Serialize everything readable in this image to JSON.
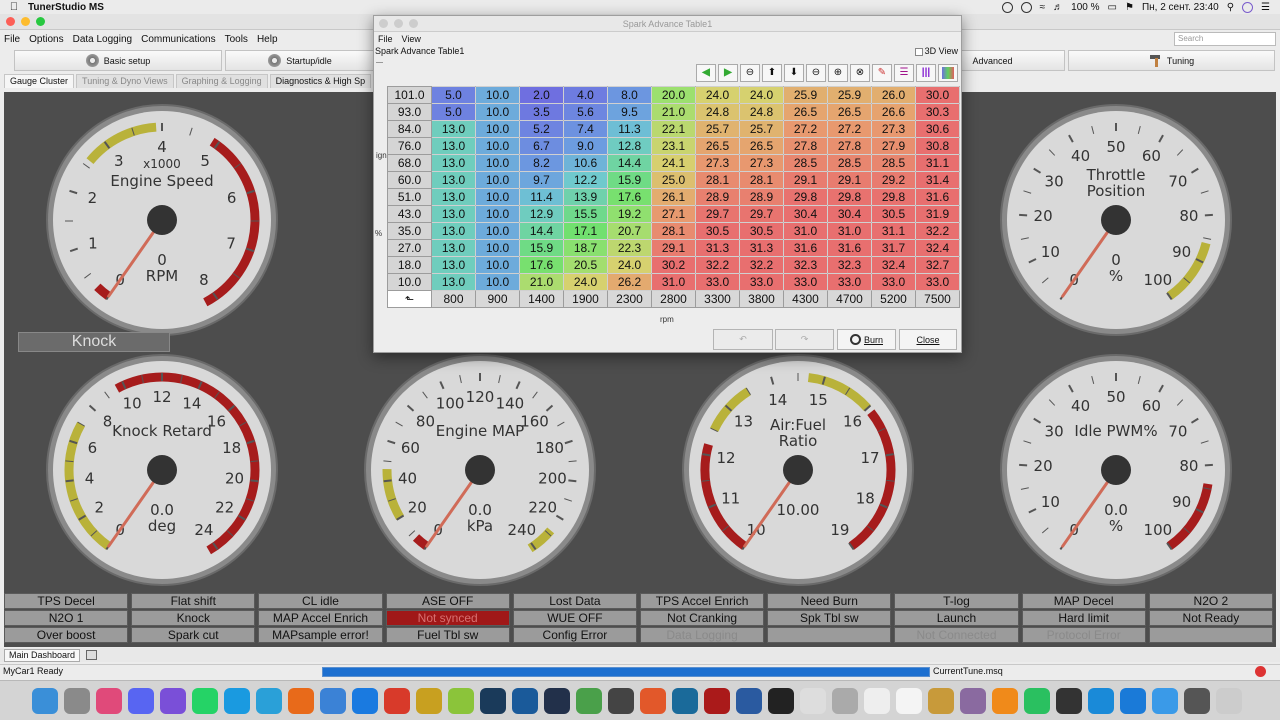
{
  "mac_menubar": {
    "app_name": "TunerStudio MS",
    "wifi": "100 %",
    "date_time": "Пн, 2 сент.  23:40"
  },
  "menu": {
    "items": [
      "File",
      "Options",
      "Data Logging",
      "Communications",
      "Tools",
      "Help"
    ],
    "search_placeholder": "Search"
  },
  "toolbar": {
    "basic_setup": "Basic setup",
    "startup_idle": "Startup/idle",
    "advanced": "Advanced",
    "tuning": "Tuning"
  },
  "tabs": [
    "Gauge Cluster",
    "Tuning & Dyno Views",
    "Graphing & Logging",
    "Diagnostics & High Sp"
  ],
  "gauges": [
    {
      "title": "Engine Speed",
      "sub": "x1000",
      "value": "0",
      "unit": "RPM",
      "ticks": [
        "0",
        "1",
        "2",
        "3",
        "4",
        "5",
        "6",
        "7",
        "8"
      ]
    },
    {
      "title": "Throttle Position",
      "value": "0",
      "unit": "%",
      "ticks": [
        "0",
        "10",
        "20",
        "30",
        "40",
        "50",
        "60",
        "70",
        "80",
        "90",
        "100"
      ]
    },
    {
      "title": "Knock Retard",
      "value": "0.0",
      "unit": "deg",
      "ticks": [
        "0",
        "2",
        "4",
        "6",
        "8",
        "10",
        "12",
        "14",
        "16",
        "18",
        "20",
        "22",
        "24"
      ]
    },
    {
      "title": "Engine MAP",
      "value": "0.0",
      "unit": "kPa",
      "ticks": [
        "0",
        "20",
        "40",
        "60",
        "80",
        "100",
        "120",
        "140",
        "160",
        "180",
        "200",
        "220",
        "240"
      ]
    },
    {
      "title": "Air:Fuel Ratio",
      "value": "10.00",
      "unit": "",
      "ticks": [
        "10",
        "11",
        "12",
        "13",
        "14",
        "15",
        "16",
        "17",
        "18",
        "19"
      ]
    },
    {
      "title": "Idle PWM%",
      "value": "0.0",
      "unit": "%",
      "ticks": [
        "0",
        "10",
        "20",
        "30",
        "40",
        "50",
        "60",
        "70",
        "80",
        "90",
        "100"
      ]
    }
  ],
  "knock_panel": "Knock",
  "indicators": [
    [
      "TPS Decel",
      "N2O 1",
      "Over boost"
    ],
    [
      "Flat shift",
      "Knock",
      "Spark cut"
    ],
    [
      "CL idle",
      "MAP Accel Enrich",
      "MAPsample error!"
    ],
    [
      "ASE OFF",
      "Not synced",
      "Fuel Tbl sw"
    ],
    [
      "Lost Data",
      "WUE OFF",
      "Config Error"
    ],
    [
      "TPS Accel Enrich",
      "Not Cranking",
      "Data Logging"
    ],
    [
      "Need Burn",
      "Spk Tbl sw",
      ""
    ],
    [
      "T-log",
      "Launch",
      "Not Connected"
    ],
    [
      "MAP Decel",
      "Hard limit",
      "Protocol Error"
    ],
    [
      "N2O 2",
      "Not Ready",
      ""
    ]
  ],
  "bottom": {
    "tab": "Main Dashboard",
    "status": "MyCar1 Ready",
    "file": "CurrentTune.msq"
  },
  "dialog": {
    "title": "Spark Advance Table1",
    "menu": [
      "File",
      "View"
    ],
    "header": "Spark Advance Table1",
    "view3d": "3D View",
    "y_axis_label": "ignload",
    "y_axis_unit": "%",
    "x_axis_label": "rpm",
    "buttons": {
      "burn": "Burn",
      "close": "Close"
    },
    "table": {
      "rows_load": [
        "101.0",
        "93.0",
        "84.0",
        "76.0",
        "68.0",
        "60.0",
        "51.0",
        "43.0",
        "35.0",
        "27.0",
        "18.0",
        "10.0"
      ],
      "cols_rpm": [
        "800",
        "900",
        "1400",
        "1900",
        "2300",
        "2800",
        "3300",
        "3800",
        "4300",
        "4700",
        "5200",
        "7500"
      ],
      "values": [
        [
          "5.0",
          "10.0",
          "2.0",
          "4.0",
          "8.0",
          "20.0",
          "24.0",
          "24.0",
          "25.9",
          "25.9",
          "26.0",
          "30.0"
        ],
        [
          "5.0",
          "10.0",
          "3.5",
          "5.6",
          "9.5",
          "21.0",
          "24.8",
          "24.8",
          "26.5",
          "26.5",
          "26.6",
          "30.3"
        ],
        [
          "13.0",
          "10.0",
          "5.2",
          "7.4",
          "11.3",
          "22.1",
          "25.7",
          "25.7",
          "27.2",
          "27.2",
          "27.3",
          "30.6"
        ],
        [
          "13.0",
          "10.0",
          "6.7",
          "9.0",
          "12.8",
          "23.1",
          "26.5",
          "26.5",
          "27.8",
          "27.8",
          "27.9",
          "30.8"
        ],
        [
          "13.0",
          "10.0",
          "8.2",
          "10.6",
          "14.4",
          "24.1",
          "27.3",
          "27.3",
          "28.5",
          "28.5",
          "28.5",
          "31.1"
        ],
        [
          "13.0",
          "10.0",
          "9.7",
          "12.2",
          "15.9",
          "25.0",
          "28.1",
          "28.1",
          "29.1",
          "29.1",
          "29.2",
          "31.4"
        ],
        [
          "13.0",
          "10.0",
          "11.4",
          "13.9",
          "17.6",
          "26.1",
          "28.9",
          "28.9",
          "29.8",
          "29.8",
          "29.8",
          "31.6"
        ],
        [
          "13.0",
          "10.0",
          "12.9",
          "15.5",
          "19.2",
          "27.1",
          "29.7",
          "29.7",
          "30.4",
          "30.4",
          "30.5",
          "31.9"
        ],
        [
          "13.0",
          "10.0",
          "14.4",
          "17.1",
          "20.7",
          "28.1",
          "30.5",
          "30.5",
          "31.0",
          "31.0",
          "31.1",
          "32.2"
        ],
        [
          "13.0",
          "10.0",
          "15.9",
          "18.7",
          "22.3",
          "29.1",
          "31.3",
          "31.3",
          "31.6",
          "31.6",
          "31.7",
          "32.4"
        ],
        [
          "13.0",
          "10.0",
          "17.6",
          "20.5",
          "24.0",
          "30.2",
          "32.2",
          "32.2",
          "32.3",
          "32.3",
          "32.4",
          "32.7"
        ],
        [
          "13.0",
          "10.0",
          "21.0",
          "24.0",
          "26.2",
          "31.0",
          "33.0",
          "33.0",
          "33.0",
          "33.0",
          "33.0",
          "33.0"
        ]
      ]
    }
  }
}
